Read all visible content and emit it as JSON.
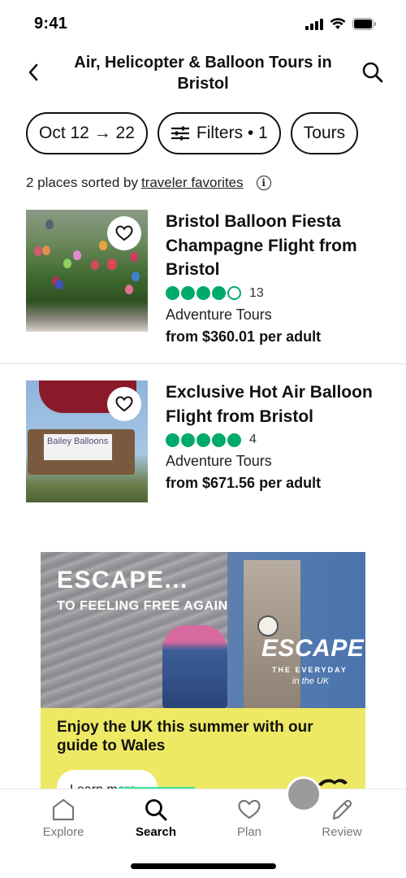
{
  "status_bar": {
    "time": "9:41"
  },
  "header": {
    "title": "Air, Helicopter & Balloon Tours in Bristol",
    "back_icon": "chevron-left-icon",
    "search_icon": "search-icon"
  },
  "chips": [
    {
      "label": "Oct 12 → 22"
    },
    {
      "label": "Filters • 1",
      "icon": "sliders-icon"
    },
    {
      "label": "Tours"
    }
  ],
  "sort": {
    "prefix": "2 places sorted by",
    "link": "traveler favorites",
    "info_icon": "i"
  },
  "listings": [
    {
      "title": "Bristol Balloon Fiesta Champagne Flight from Bristol",
      "rating": 4,
      "rating_max": 5,
      "review_count": "13",
      "category": "Adventure Tours",
      "price": "from $360.01 per adult",
      "saved": false
    },
    {
      "title": "Exclusive Hot Air Balloon Flight from Bristol",
      "rating": 5,
      "rating_max": 5,
      "review_count": "4",
      "category": "Adventure Tours",
      "price": "from $671.56 per adult",
      "saved": false,
      "image_text": "Bailey Balloons"
    }
  ],
  "ad": {
    "headline": "ESCAPE...",
    "subheadline": "TO FEELING FREE AGAIN",
    "brand": "ESCAPE",
    "brand_sub": "THE EVERYDAY",
    "brand_sub2": "in the UK",
    "body": "Enjoy the UK this summer with our guide to Wales",
    "cta": "Learn more",
    "colors": {
      "panel": "#eee964"
    }
  },
  "progress": {
    "color": "#3ee39a"
  },
  "tab_bar": {
    "tabs": [
      {
        "label": "Explore",
        "icon": "home-icon",
        "active": false
      },
      {
        "label": "Search",
        "icon": "search-icon",
        "active": true
      },
      {
        "label": "Plan",
        "icon": "heart-icon",
        "active": false
      },
      {
        "label": "Review",
        "icon": "pencil-icon",
        "active": false
      }
    ]
  },
  "colors": {
    "rating_green": "#00aa6c",
    "text": "#111111"
  }
}
